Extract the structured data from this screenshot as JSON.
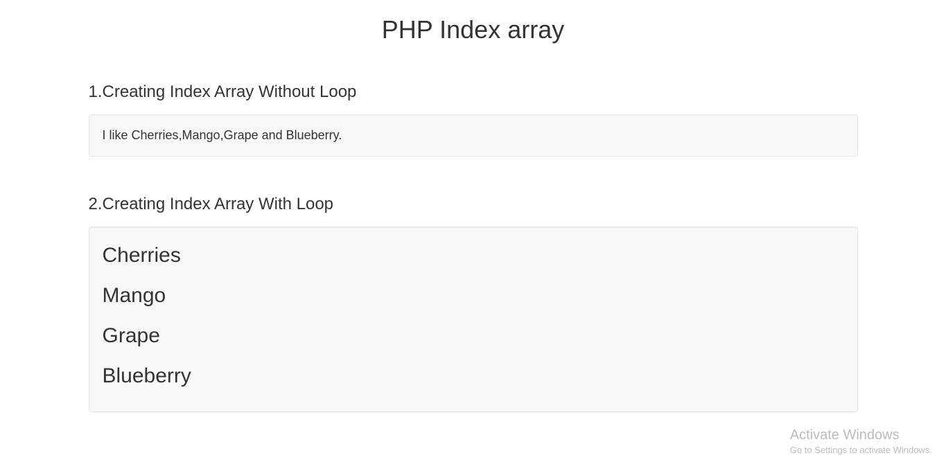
{
  "title": "PHP Index array",
  "sections": [
    {
      "heading": "1.Creating Index Array Without Loop",
      "content": "I like Cherries,Mango,Grape and Blueberry."
    },
    {
      "heading": "2.Creating Index Array With Loop",
      "items": [
        "Cherries",
        "Mango",
        "Grape",
        "Blueberry"
      ]
    }
  ],
  "watermark": {
    "title": "Activate Windows",
    "subtitle": "Go to Settings to activate Windows."
  }
}
